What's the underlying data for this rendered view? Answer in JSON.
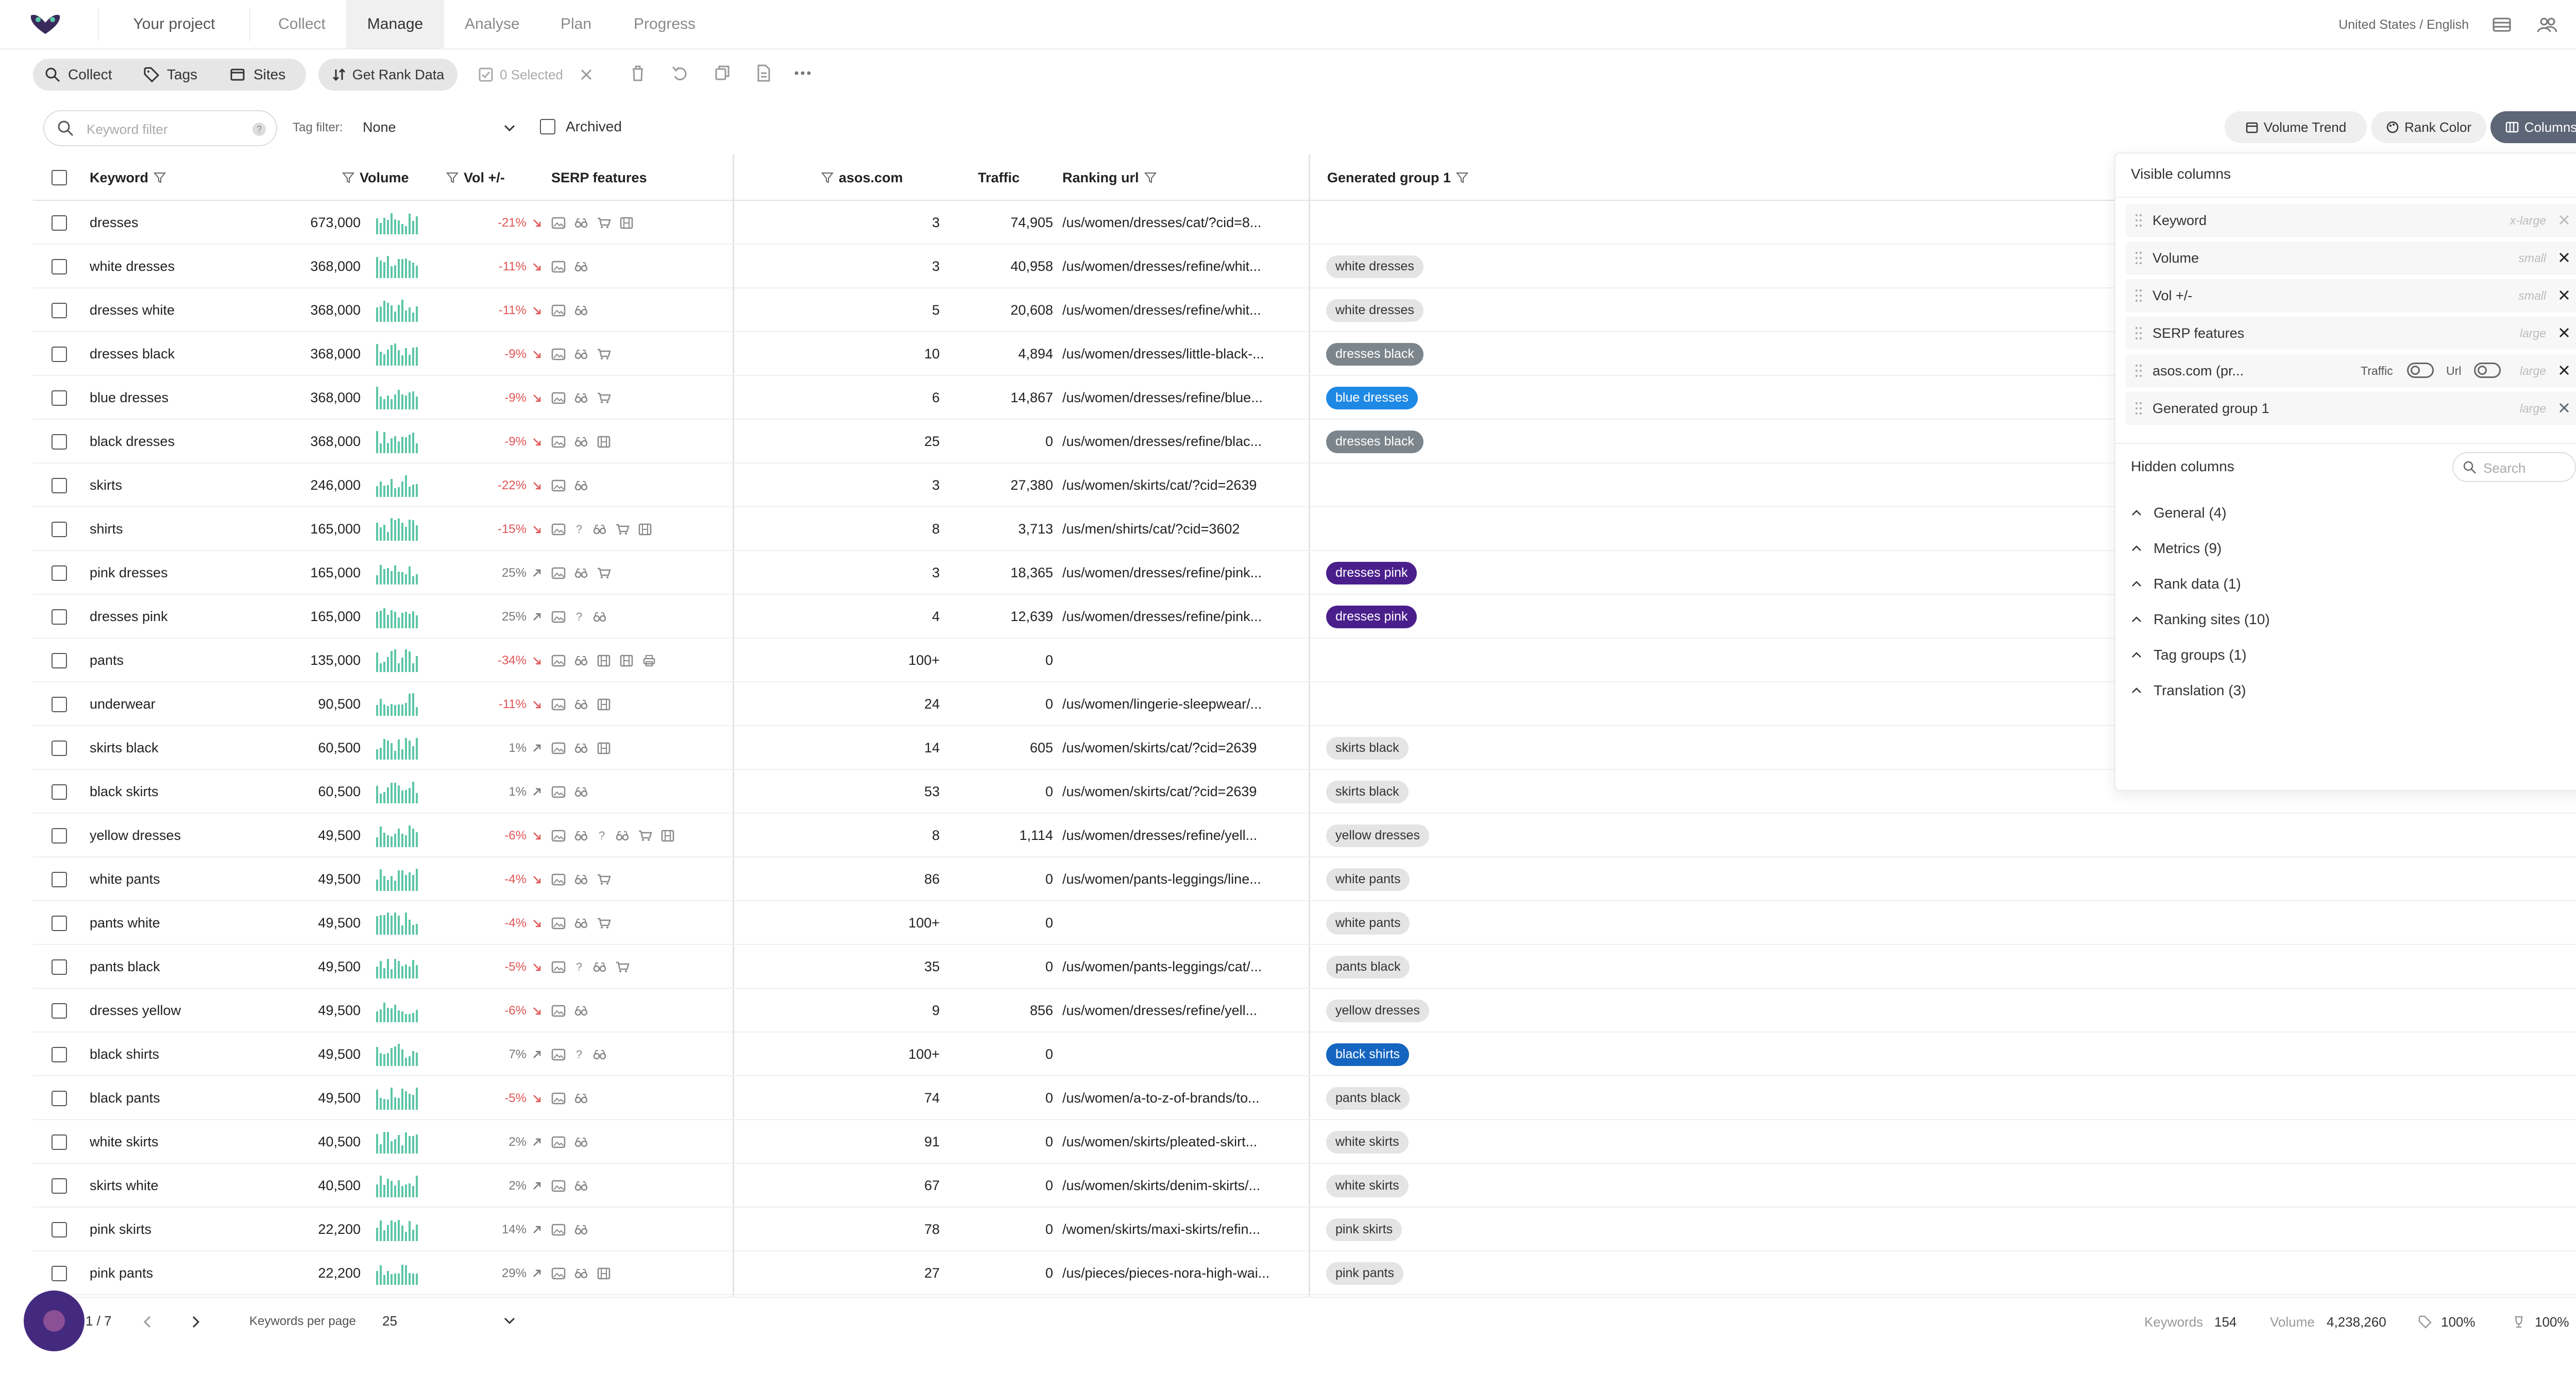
{
  "nav": {
    "project": "Your project",
    "tabs": [
      "Collect",
      "Manage",
      "Analyse",
      "Plan",
      "Progress"
    ],
    "active_tab": "Manage",
    "locale": "United States / English"
  },
  "toolbar": {
    "collect": "Collect",
    "tags": "Tags",
    "sites": "Sites",
    "get_rank_data": "Get Rank Data",
    "selected": "0 Selected"
  },
  "filters": {
    "keyword_placeholder": "Keyword filter",
    "tag_filter_label": "Tag filter:",
    "tag_filter_value": "None",
    "archived_label": "Archived",
    "volume_trend": "Volume Trend",
    "rank_color": "Rank Color",
    "columns": "Columns"
  },
  "table": {
    "headers": {
      "keyword": "Keyword",
      "volume": "Volume",
      "vol_change": "Vol +/-",
      "serp": "SERP features",
      "site": "asos.com",
      "traffic": "Traffic",
      "ranking_url": "Ranking url",
      "group": "Generated group 1"
    },
    "rows": [
      {
        "keyword": "dresses",
        "volume": "673,000",
        "change": "-21%",
        "dir": "down",
        "serp": [
          "img",
          "bino",
          "cart",
          "film"
        ],
        "rank": "3",
        "traffic": "74,905",
        "url": "/us/women/dresses/cat/?cid=8...",
        "group": ""
      },
      {
        "keyword": "white dresses",
        "volume": "368,000",
        "change": "-11%",
        "dir": "down",
        "serp": [
          "img",
          "bino"
        ],
        "rank": "3",
        "traffic": "40,958",
        "url": "/us/women/dresses/refine/whit...",
        "group": "white dresses"
      },
      {
        "keyword": "dresses white",
        "volume": "368,000",
        "change": "-11%",
        "dir": "down",
        "serp": [
          "img",
          "bino"
        ],
        "rank": "5",
        "traffic": "20,608",
        "url": "/us/women/dresses/refine/whit...",
        "group": "white dresses"
      },
      {
        "keyword": "dresses black",
        "volume": "368,000",
        "change": "-9%",
        "dir": "down",
        "serp": [
          "img",
          "bino",
          "cart"
        ],
        "rank": "10",
        "traffic": "4,894",
        "url": "/us/women/dresses/little-black-...",
        "group": "dresses black"
      },
      {
        "keyword": "blue dresses",
        "volume": "368,000",
        "change": "-9%",
        "dir": "down",
        "serp": [
          "img",
          "bino",
          "cart"
        ],
        "rank": "6",
        "traffic": "14,867",
        "url": "/us/women/dresses/refine/blue...",
        "group": "blue dresses"
      },
      {
        "keyword": "black dresses",
        "volume": "368,000",
        "change": "-9%",
        "dir": "down",
        "serp": [
          "img",
          "bino",
          "film"
        ],
        "rank": "25",
        "traffic": "0",
        "url": "/us/women/dresses/refine/blac...",
        "group": "dresses black"
      },
      {
        "keyword": "skirts",
        "volume": "246,000",
        "change": "-22%",
        "dir": "down",
        "serp": [
          "img",
          "bino"
        ],
        "rank": "3",
        "traffic": "27,380",
        "url": "/us/women/skirts/cat/?cid=2639",
        "group": ""
      },
      {
        "keyword": "shirts",
        "volume": "165,000",
        "change": "-15%",
        "dir": "down",
        "serp": [
          "img",
          "q",
          "bino",
          "cart",
          "film"
        ],
        "rank": "8",
        "traffic": "3,713",
        "url": "/us/men/shirts/cat/?cid=3602",
        "group": ""
      },
      {
        "keyword": "pink dresses",
        "volume": "165,000",
        "change": "25%",
        "dir": "up",
        "serp": [
          "img",
          "bino",
          "cart"
        ],
        "rank": "3",
        "traffic": "18,365",
        "url": "/us/women/dresses/refine/pink...",
        "group": "dresses pink"
      },
      {
        "keyword": "dresses pink",
        "volume": "165,000",
        "change": "25%",
        "dir": "up",
        "serp": [
          "img",
          "q",
          "bino"
        ],
        "rank": "4",
        "traffic": "12,639",
        "url": "/us/women/dresses/refine/pink...",
        "group": "dresses pink"
      },
      {
        "keyword": "pants",
        "volume": "135,000",
        "change": "-34%",
        "dir": "down",
        "serp": [
          "img",
          "bino",
          "film",
          "film",
          "print"
        ],
        "rank": "100+",
        "traffic": "0",
        "url": "",
        "group": ""
      },
      {
        "keyword": "underwear",
        "volume": "90,500",
        "change": "-11%",
        "dir": "down",
        "serp": [
          "img",
          "bino",
          "film"
        ],
        "rank": "24",
        "traffic": "0",
        "url": "/us/women/lingerie-sleepwear/...",
        "group": ""
      },
      {
        "keyword": "skirts black",
        "volume": "60,500",
        "change": "1%",
        "dir": "up",
        "serp": [
          "img",
          "bino",
          "film"
        ],
        "rank": "14",
        "traffic": "605",
        "url": "/us/women/skirts/cat/?cid=2639",
        "group": "skirts black"
      },
      {
        "keyword": "black skirts",
        "volume": "60,500",
        "change": "1%",
        "dir": "up",
        "serp": [
          "img",
          "bino"
        ],
        "rank": "53",
        "traffic": "0",
        "url": "/us/women/skirts/cat/?cid=2639",
        "group": "skirts black"
      },
      {
        "keyword": "yellow dresses",
        "volume": "49,500",
        "change": "-6%",
        "dir": "down",
        "serp": [
          "img",
          "bino",
          "q",
          "bino",
          "cart",
          "film"
        ],
        "rank": "8",
        "traffic": "1,114",
        "url": "/us/women/dresses/refine/yell...",
        "group": "yellow dresses"
      },
      {
        "keyword": "white pants",
        "volume": "49,500",
        "change": "-4%",
        "dir": "down",
        "serp": [
          "img",
          "bino",
          "cart"
        ],
        "rank": "86",
        "traffic": "0",
        "url": "/us/women/pants-leggings/line...",
        "group": "white pants"
      },
      {
        "keyword": "pants white",
        "volume": "49,500",
        "change": "-4%",
        "dir": "down",
        "serp": [
          "img",
          "bino",
          "cart"
        ],
        "rank": "100+",
        "traffic": "0",
        "url": "",
        "group": "white pants"
      },
      {
        "keyword": "pants black",
        "volume": "49,500",
        "change": "-5%",
        "dir": "down",
        "serp": [
          "img",
          "q",
          "bino",
          "cart"
        ],
        "rank": "35",
        "traffic": "0",
        "url": "/us/women/pants-leggings/cat/...",
        "group": "pants black"
      },
      {
        "keyword": "dresses yellow",
        "volume": "49,500",
        "change": "-6%",
        "dir": "down",
        "serp": [
          "img",
          "bino"
        ],
        "rank": "9",
        "traffic": "856",
        "url": "/us/women/dresses/refine/yell...",
        "group": "yellow dresses"
      },
      {
        "keyword": "black shirts",
        "volume": "49,500",
        "change": "7%",
        "dir": "up",
        "serp": [
          "img",
          "q",
          "bino"
        ],
        "rank": "100+",
        "traffic": "0",
        "url": "",
        "group": "black shirts"
      },
      {
        "keyword": "black pants",
        "volume": "49,500",
        "change": "-5%",
        "dir": "down",
        "serp": [
          "img",
          "bino"
        ],
        "rank": "74",
        "traffic": "0",
        "url": "/us/women/a-to-z-of-brands/to...",
        "group": "pants black"
      },
      {
        "keyword": "white skirts",
        "volume": "40,500",
        "change": "2%",
        "dir": "up",
        "serp": [
          "img",
          "bino"
        ],
        "rank": "91",
        "traffic": "0",
        "url": "/us/women/skirts/pleated-skirt...",
        "group": "white skirts"
      },
      {
        "keyword": "skirts white",
        "volume": "40,500",
        "change": "2%",
        "dir": "up",
        "serp": [
          "img",
          "bino"
        ],
        "rank": "67",
        "traffic": "0",
        "url": "/us/women/skirts/denim-skirts/...",
        "group": "white skirts"
      },
      {
        "keyword": "pink skirts",
        "volume": "22,200",
        "change": "14%",
        "dir": "up",
        "serp": [
          "img",
          "bino"
        ],
        "rank": "78",
        "traffic": "0",
        "url": "/women/skirts/maxi-skirts/refin...",
        "group": "pink skirts"
      },
      {
        "keyword": "pink pants",
        "volume": "22,200",
        "change": "29%",
        "dir": "up",
        "serp": [
          "img",
          "bino",
          "film"
        ],
        "rank": "27",
        "traffic": "0",
        "url": "/us/pieces/pieces-nora-high-wai...",
        "group": "pink pants"
      }
    ]
  },
  "group_colors": {
    "white dresses": {
      "bg": "#e4e4e4",
      "fg": "#333333"
    },
    "dresses black": {
      "bg": "#7c858b",
      "fg": "#ffffff"
    },
    "blue dresses": {
      "bg": "#1e88e5",
      "fg": "#ffffff"
    },
    "dresses pink": {
      "bg": "#4a1f8c",
      "fg": "#ffffff"
    },
    "skirts black": {
      "bg": "#e4e4e4",
      "fg": "#333333"
    },
    "yellow dresses": {
      "bg": "#e4e4e4",
      "fg": "#333333"
    },
    "white pants": {
      "bg": "#e4e4e4",
      "fg": "#333333"
    },
    "pants black": {
      "bg": "#e4e4e4",
      "fg": "#333333"
    },
    "black shirts": {
      "bg": "#1565c0",
      "fg": "#ffffff"
    },
    "white skirts": {
      "bg": "#e4e4e4",
      "fg": "#333333"
    },
    "pink skirts": {
      "bg": "#e4e4e4",
      "fg": "#333333"
    },
    "pink pants": {
      "bg": "#e4e4e4",
      "fg": "#333333"
    }
  },
  "columns_panel": {
    "visible_title": "Visible columns",
    "visible": [
      {
        "name": "Keyword",
        "size": "x-large"
      },
      {
        "name": "Volume",
        "size": "small"
      },
      {
        "name": "Vol +/-",
        "size": "small"
      },
      {
        "name": "SERP features",
        "size": "large"
      },
      {
        "name": "asos.com (pr...",
        "size": "large",
        "traffic_label": "Traffic",
        "url_label": "Url"
      },
      {
        "name": "Generated group 1",
        "size": "large"
      }
    ],
    "hidden_title": "Hidden columns",
    "search_placeholder": "Search",
    "hidden_sections": [
      "General (4)",
      "Metrics (9)",
      "Rank data (1)",
      "Ranking sites (10)",
      "Tag groups (1)",
      "Translation (3)"
    ]
  },
  "footer": {
    "page": "1 / 7",
    "per_page_label": "Keywords per page",
    "per_page_value": "25",
    "keywords_label": "Keywords",
    "keywords_value": "154",
    "volume_label": "Volume",
    "volume_value": "4,238,260",
    "pct1": "100%",
    "pct2": "100%"
  },
  "colors": {
    "accent": "#5d6676",
    "bars": "#5cc6a6",
    "negative": "#e05555",
    "fab": "#442a7f"
  }
}
